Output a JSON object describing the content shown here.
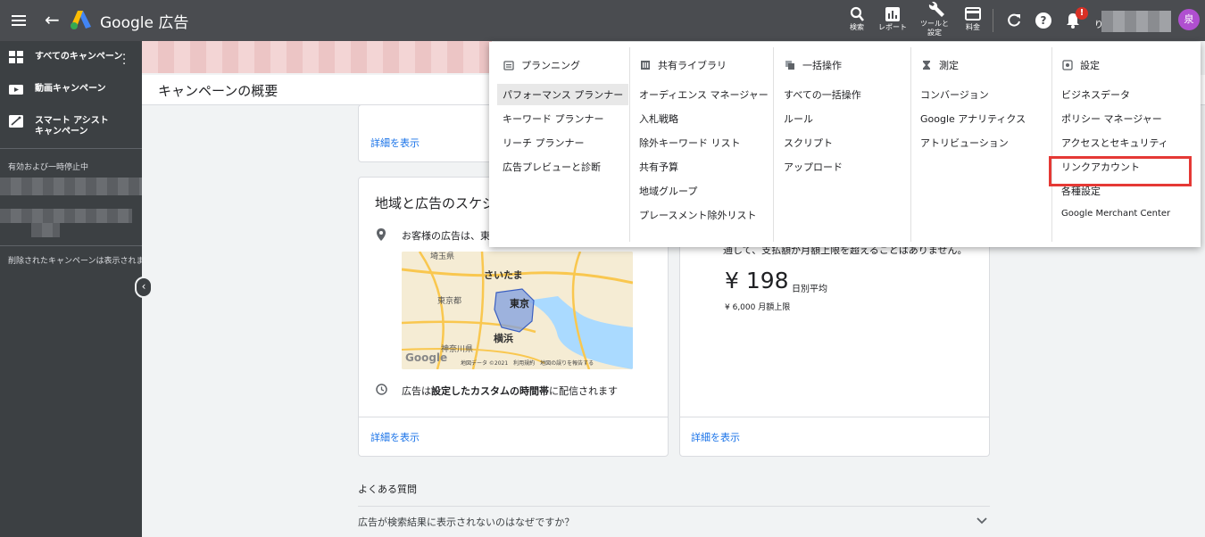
{
  "topbar": {
    "app_title": "Google 広告",
    "icons": [
      {
        "name": "search",
        "label": "検索"
      },
      {
        "name": "report",
        "label": "レポート"
      },
      {
        "name": "tools",
        "label": "ツールと\n設定"
      },
      {
        "name": "billing",
        "label": "料金"
      }
    ],
    "notification_badge": "!",
    "account_prefix": "り",
    "avatar_letter": "泉"
  },
  "sidebar": {
    "items": [
      {
        "label": "すべてのキャンペーン",
        "icon": "grid-icon"
      },
      {
        "label": "動画キャンペーン",
        "icon": "video-icon"
      },
      {
        "label": "スマート アシスト\nキャンペーン",
        "icon": "smart-assist-icon"
      }
    ],
    "section_active": "有効および一時停止中",
    "removed_note": "削除されたキャンペーンは表示されま"
  },
  "main": {
    "page_title": "キャンペーンの概要",
    "details_link": "詳細を表示",
    "location_card": {
      "title": "地域と広告のスケジ",
      "location_text": "お客様の広告は、東",
      "schedule_prefix": "広告は",
      "schedule_bold": "設定したカスタムの時間帯",
      "schedule_suffix": "に配信されます",
      "map_labels": [
        "埼玉県",
        "さいたま",
        "東京都",
        "東京",
        "横浜",
        "神奈川県"
      ],
      "map_attr": "地図データ ©2021　利用規約　地図の誤りを報告する",
      "map_logo": "Google"
    },
    "budget_card": {
      "cut_text": "通して、支払額が月額上限を超えることはありません。",
      "price": "¥ 198",
      "price_sub": "日別平均",
      "monthly": "¥ 6,000 月額上限"
    },
    "faq": {
      "title": "よくある質問",
      "question": "広告が検索結果に表示されないのはなぜですか？"
    }
  },
  "dropdown": {
    "columns": [
      {
        "heading": "プランニング",
        "icon": "calendar-icon",
        "items": [
          "パフォーマンス プランナー",
          "キーワード プランナー",
          "リーチ プランナー",
          "広告プレビューと診断"
        ]
      },
      {
        "heading": "共有ライブラリ",
        "icon": "library-icon",
        "items": [
          "オーディエンス マネージャー",
          "入札戦略",
          "除外キーワード リスト",
          "共有予算",
          "地域グループ",
          "プレースメント除外リスト"
        ]
      },
      {
        "heading": "一括操作",
        "icon": "bulk-icon",
        "items": [
          "すべての一括操作",
          "ルール",
          "スクリプト",
          "アップロード"
        ]
      },
      {
        "heading": "測定",
        "icon": "hourglass-icon",
        "items": [
          "コンバージョン",
          "Google アナリティクス",
          "アトリビューション"
        ]
      },
      {
        "heading": "設定",
        "icon": "settings-icon",
        "items": [
          "ビジネスデータ",
          "ポリシー マネージャー",
          "アクセスとセキュリティ",
          "リンクアカウント",
          "各種設定",
          "Google Merchant Center"
        ]
      }
    ]
  },
  "colors": {
    "topbar": "#4a4c50",
    "sidebar": "#3c4043",
    "link": "#1a73e8",
    "highlight": "#e53935",
    "avatar": "#b04fd0"
  }
}
